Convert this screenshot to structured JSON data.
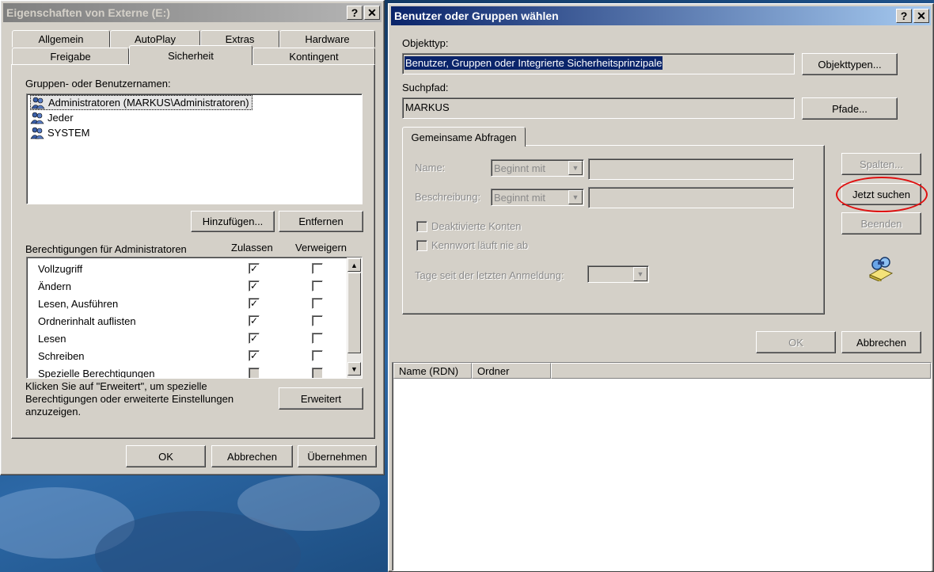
{
  "left_dialog": {
    "title": "Eigenschaften von Externe (E:)",
    "title_buttons": {
      "help": "?",
      "close": "✕"
    },
    "tabs_row1": [
      "Allgemein",
      "AutoPlay",
      "Extras",
      "Hardware"
    ],
    "tabs_row2": [
      "Freigabe",
      "Sicherheit",
      "Kontingent"
    ],
    "selected_tab": "Sicherheit",
    "group_label": "Gruppen- oder Benutzernamen:",
    "users": [
      {
        "name": "Administratoren (MARKUS\\Administratoren)",
        "icon": "user-group-icon",
        "selected": true
      },
      {
        "name": "Jeder",
        "icon": "user-group-icon"
      },
      {
        "name": "SYSTEM",
        "icon": "user-group-icon"
      }
    ],
    "add_button": "Hinzufügen...",
    "remove_button": "Entfernen",
    "permissions_label": "Berechtigungen für Administratoren",
    "allow_header": "Zulassen",
    "deny_header": "Verweigern",
    "permissions": [
      {
        "name": "Vollzugriff",
        "allow": true,
        "deny": false
      },
      {
        "name": "Ändern",
        "allow": true,
        "deny": false
      },
      {
        "name": "Lesen, Ausführen",
        "allow": true,
        "deny": false
      },
      {
        "name": "Ordnerinhalt auflisten",
        "allow": true,
        "deny": false
      },
      {
        "name": "Lesen",
        "allow": true,
        "deny": false
      },
      {
        "name": "Schreiben",
        "allow": true,
        "deny": false
      },
      {
        "name": "Spezielle Berechtigungen",
        "allow": false,
        "deny": false,
        "disabled": true
      }
    ],
    "advanced_text": "Klicken Sie auf \"Erweitert\", um spezielle Berechtigungen oder erweiterte Einstellungen anzuzeigen.",
    "advanced_button": "Erweitert",
    "ok_button": "OK",
    "cancel_button": "Abbrechen",
    "apply_button": "Übernehmen"
  },
  "right_dialog": {
    "title": "Benutzer oder Gruppen wählen",
    "title_buttons": {
      "help": "?",
      "close": "✕"
    },
    "object_type_label": "Objekttyp:",
    "object_type_value": "Benutzer, Gruppen oder Integrierte Sicherheitsprinzipale",
    "object_types_button": "Objekttypen...",
    "path_label": "Suchpfad:",
    "path_value": "MARKUS",
    "paths_button": "Pfade...",
    "query_tab": "Gemeinsame Abfragen",
    "name_label": "Name:",
    "name_combo": "Beginnt mit",
    "description_label": "Beschreibung:",
    "description_combo": "Beginnt mit",
    "disabled_accounts": "Deaktivierte Konten",
    "password_never_expires": "Kennwort läuft nie ab",
    "days_since_logon": "Tage seit der letzten Anmeldung:",
    "columns_button": "Spalten...",
    "search_now_button": "Jetzt suchen",
    "stop_button": "Beenden",
    "ok_button": "OK",
    "cancel_button": "Abbrechen",
    "results_columns": [
      "Name (RDN)",
      "Ordner"
    ],
    "highlight_color": "#e01010",
    "selection_color": "#0a246a"
  }
}
